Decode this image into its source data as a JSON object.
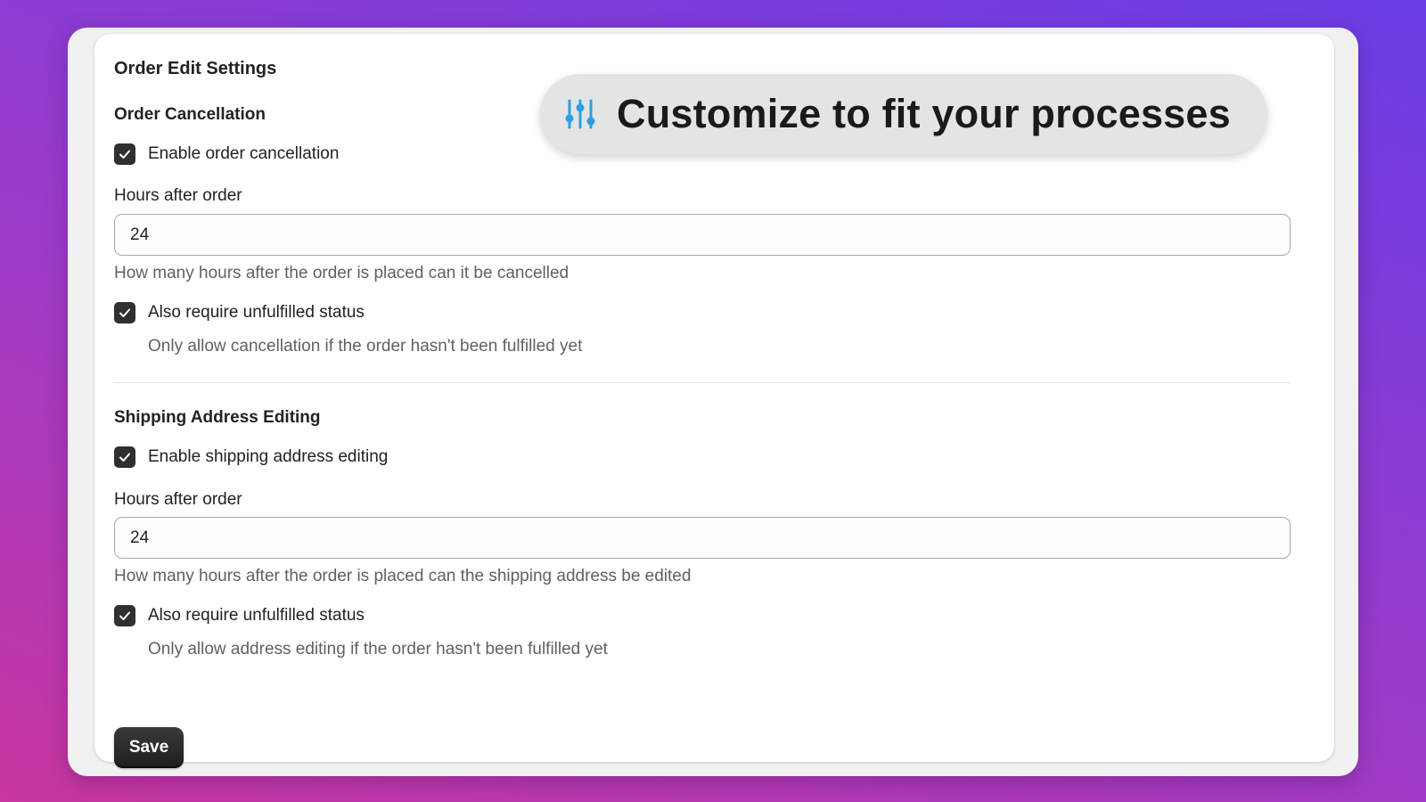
{
  "card": {
    "title": "Order Edit Settings"
  },
  "cancellation": {
    "section_title": "Order Cancellation",
    "enable_label": "Enable order cancellation",
    "enable_checked": true,
    "hours_label": "Hours after order",
    "hours_value": "24",
    "hours_help": "How many hours after the order is placed can it be cancelled",
    "unfulfilled_label": "Also require unfulfilled status",
    "unfulfilled_checked": true,
    "unfulfilled_help": "Only allow cancellation if the order hasn't been fulfilled yet"
  },
  "shipping": {
    "section_title": "Shipping Address Editing",
    "enable_label": "Enable shipping address editing",
    "enable_checked": true,
    "hours_label": "Hours after order",
    "hours_value": "24",
    "hours_help": "How many hours after the order is placed can the shipping address be edited",
    "unfulfilled_label": "Also require unfulfilled status",
    "unfulfilled_checked": true,
    "unfulfilled_help": "Only allow address editing if the order hasn't been fulfilled yet"
  },
  "actions": {
    "save_label": "Save"
  },
  "overlay": {
    "icon": "sliders-icon",
    "icon_color": "#2aa0e0",
    "text": "Customize to fit your processes"
  }
}
